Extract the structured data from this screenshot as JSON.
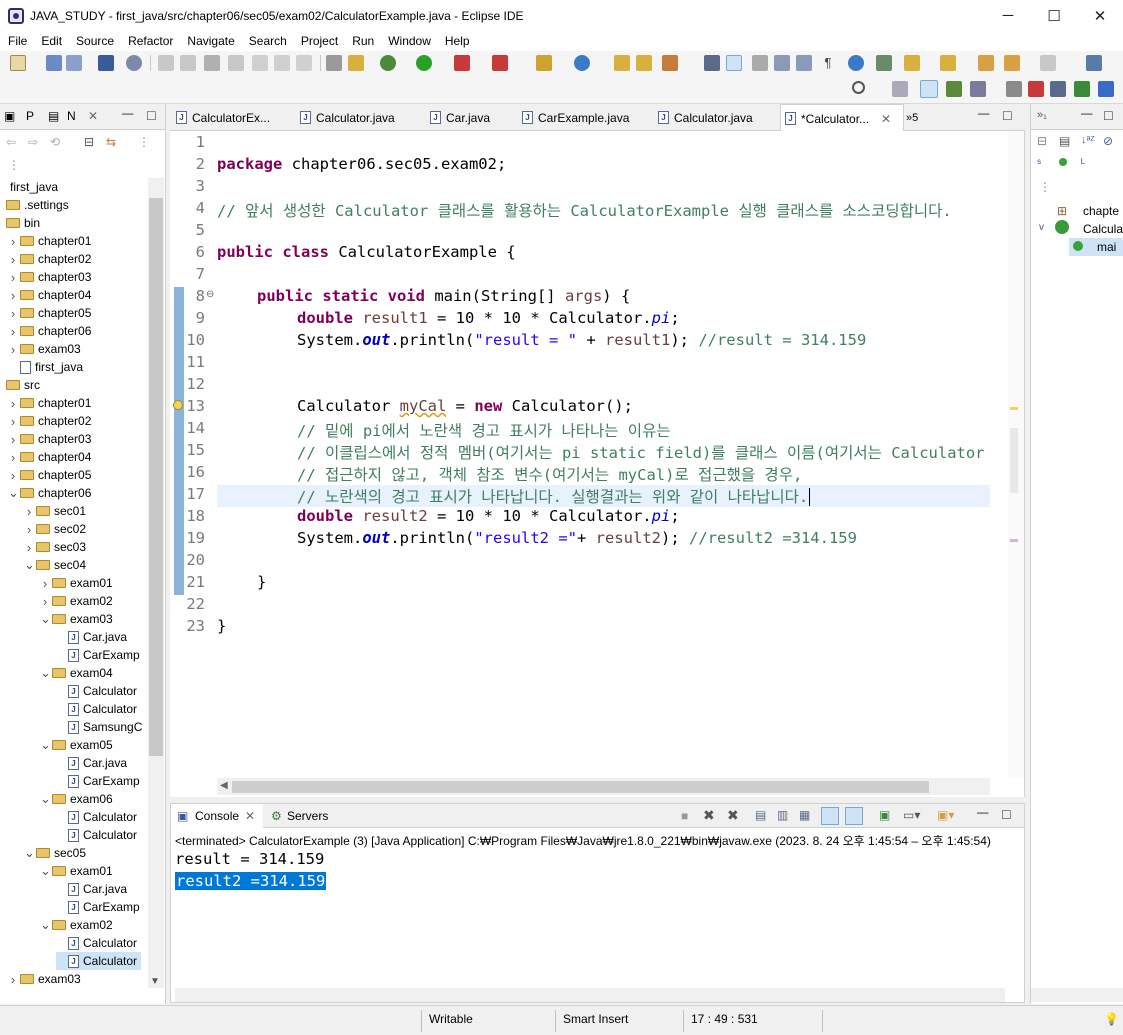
{
  "window": {
    "title": "JAVA_STUDY - first_java/src/chapter06/sec05/exam02/CalculatorExample.java - Eclipse IDE",
    "minimize": "─",
    "maximize": "☐",
    "close": "✕"
  },
  "menu": [
    "File",
    "Edit",
    "Source",
    "Refactor",
    "Navigate",
    "Search",
    "Project",
    "Run",
    "Window",
    "Help"
  ],
  "left_panel": {
    "tab1": "P",
    "tab2": "N",
    "tree": [
      {
        "label": "first_java",
        "depth": 0,
        "kind": "project",
        "chevron": ""
      },
      {
        "label": ".settings",
        "depth": 0,
        "kind": "folder",
        "chevron": ""
      },
      {
        "label": "bin",
        "depth": 0,
        "kind": "folder",
        "chevron": ""
      },
      {
        "label": "chapter01",
        "depth": 1,
        "kind": "folder",
        "chevron": ">"
      },
      {
        "label": "chapter02",
        "depth": 1,
        "kind": "folder",
        "chevron": ">"
      },
      {
        "label": "chapter03",
        "depth": 1,
        "kind": "folder",
        "chevron": ">"
      },
      {
        "label": "chapter04",
        "depth": 1,
        "kind": "folder",
        "chevron": ">"
      },
      {
        "label": "chapter05",
        "depth": 1,
        "kind": "folder",
        "chevron": ">"
      },
      {
        "label": "chapter06",
        "depth": 1,
        "kind": "folder",
        "chevron": ">"
      },
      {
        "label": "exam03",
        "depth": 1,
        "kind": "folder",
        "chevron": ">"
      },
      {
        "label": "first_java",
        "depth": 1,
        "kind": "file",
        "chevron": ""
      },
      {
        "label": "src",
        "depth": 0,
        "kind": "folder",
        "chevron": ""
      },
      {
        "label": "chapter01",
        "depth": 1,
        "kind": "folder",
        "chevron": ">"
      },
      {
        "label": "chapter02",
        "depth": 1,
        "kind": "folder",
        "chevron": ">"
      },
      {
        "label": "chapter03",
        "depth": 1,
        "kind": "folder",
        "chevron": ">"
      },
      {
        "label": "chapter04",
        "depth": 1,
        "kind": "folder",
        "chevron": ">"
      },
      {
        "label": "chapter05",
        "depth": 1,
        "kind": "folder",
        "chevron": ">"
      },
      {
        "label": "chapter06",
        "depth": 1,
        "kind": "folder",
        "chevron": "v"
      },
      {
        "label": "sec01",
        "depth": 2,
        "kind": "folder",
        "chevron": ">"
      },
      {
        "label": "sec02",
        "depth": 2,
        "kind": "folder",
        "chevron": ">"
      },
      {
        "label": "sec03",
        "depth": 2,
        "kind": "folder",
        "chevron": ">"
      },
      {
        "label": "sec04",
        "depth": 2,
        "kind": "folder",
        "chevron": "v"
      },
      {
        "label": "exam01",
        "depth": 3,
        "kind": "folder",
        "chevron": ">"
      },
      {
        "label": "exam02",
        "depth": 3,
        "kind": "folder",
        "chevron": ">"
      },
      {
        "label": "exam03",
        "depth": 3,
        "kind": "folder",
        "chevron": "v"
      },
      {
        "label": "Car.java",
        "depth": 4,
        "kind": "java",
        "chevron": ""
      },
      {
        "label": "CarExamp",
        "depth": 4,
        "kind": "java",
        "chevron": ""
      },
      {
        "label": "exam04",
        "depth": 3,
        "kind": "folder",
        "chevron": "v"
      },
      {
        "label": "Calculator",
        "depth": 4,
        "kind": "java",
        "chevron": ""
      },
      {
        "label": "Calculator",
        "depth": 4,
        "kind": "java",
        "chevron": ""
      },
      {
        "label": "SamsungC",
        "depth": 4,
        "kind": "java",
        "chevron": ""
      },
      {
        "label": "exam05",
        "depth": 3,
        "kind": "folder",
        "chevron": "v"
      },
      {
        "label": "Car.java",
        "depth": 4,
        "kind": "java",
        "chevron": ""
      },
      {
        "label": "CarExamp",
        "depth": 4,
        "kind": "java",
        "chevron": ""
      },
      {
        "label": "exam06",
        "depth": 3,
        "kind": "folder",
        "chevron": "v"
      },
      {
        "label": "Calculator",
        "depth": 4,
        "kind": "java",
        "chevron": ""
      },
      {
        "label": "Calculator",
        "depth": 4,
        "kind": "java",
        "chevron": ""
      },
      {
        "label": "sec05",
        "depth": 2,
        "kind": "folder",
        "chevron": "v"
      },
      {
        "label": "exam01",
        "depth": 3,
        "kind": "folder",
        "chevron": "v"
      },
      {
        "label": "Car.java",
        "depth": 4,
        "kind": "java",
        "chevron": ""
      },
      {
        "label": "CarExamp",
        "depth": 4,
        "kind": "java",
        "chevron": ""
      },
      {
        "label": "exam02",
        "depth": 3,
        "kind": "folder",
        "chevron": "v"
      },
      {
        "label": "Calculator",
        "depth": 4,
        "kind": "java",
        "chevron": ""
      },
      {
        "label": "Calculator",
        "depth": 4,
        "kind": "java",
        "chevron": "",
        "selected": true
      },
      {
        "label": "exam03",
        "depth": 1,
        "kind": "folder",
        "chevron": ">"
      }
    ]
  },
  "editor_tabs": [
    {
      "label": "CalculatorEx...",
      "active": false
    },
    {
      "label": "Calculator.java",
      "active": false
    },
    {
      "label": "Car.java",
      "active": false
    },
    {
      "label": "CarExample.java",
      "active": false
    },
    {
      "label": "Calculator.java",
      "active": false
    },
    {
      "label": "*Calculator...",
      "active": true
    },
    {
      "label": "»5",
      "active": false
    }
  ],
  "code": {
    "line_numbers": [
      "1",
      "2",
      "3",
      "4",
      "5",
      "6",
      "7",
      "8",
      "9",
      "10",
      "11",
      "12",
      "13",
      "14",
      "15",
      "16",
      "17",
      "18",
      "19",
      "20",
      "21",
      "22",
      "23"
    ],
    "l2_kw": "package",
    "l2_rest": " chapter06.sec05.exam02;",
    "l4": "// 앞서 생성한 Calculator 클래스를 활용하는 CalculatorExample 실행 클래스를 소스코딩합니다.",
    "l6_kw": "public class",
    "l6_rest": " CalculatorExample {",
    "l8_kw": "public static void",
    "l8_rest": " main(String[] ",
    "l8_args": "args",
    "l8_end": ") {",
    "l9_kw": "double",
    "l9_var": "result1",
    "l9_mid": " = 10 * 10 * Calculator.",
    "l9_fld": "pi",
    "l9_end": ";",
    "l10_a": "System.",
    "l10_out": "out",
    "l10_b": ".println(",
    "l10_str": "\"result = \"",
    "l10_c": " + ",
    "l10_var": "result1",
    "l10_d": "); ",
    "l10_cm": "//result = 314.159",
    "l13_a": "Calculator ",
    "l13_var": "myCal",
    "l13_b": " = ",
    "l13_kw": "new",
    "l13_c": " Calculator();",
    "l14": "// 밑에 pi에서 노란색 경고 표시가 나타나는 이유는",
    "l15": "// 이클립스에서 정적 멤버(여기서는 pi static field)를 클래스 이름(여기서는 Calculator",
    "l16": "// 접근하지 않고, 객체 참조 변수(여기서는 myCal)로 접근했을 경우,",
    "l17": "// 노란색의 경고 표시가 나타납니다. 실행결과는 위와 같이 나타납니다.",
    "l18_kw": "double",
    "l18_var": "result2",
    "l18_mid": " = 10 * 10 * Calculator.",
    "l18_fld": "pi",
    "l18_end": ";",
    "l19_a": "System.",
    "l19_out": "out",
    "l19_b": ".println(",
    "l19_str": "\"result2 =\"",
    "l19_c": "+ ",
    "l19_var": "result2",
    "l19_d": "); ",
    "l19_cm": "//result2 =314.159",
    "l21": "}",
    "l23": "}"
  },
  "console": {
    "tab_console": "Console",
    "tab_servers": "Servers",
    "info": "<terminated> CalculatorExample (3) [Java Application] C:₩Program Files₩Java₩jre1.8.0_221₩bin₩javaw.exe  (2023. 8. 24 오후 1:45:54 – 오후 1:45:54)",
    "line1": "result = 314.159",
    "line2": "result2 =314.159"
  },
  "right_panel": {
    "items": [
      "chapte",
      "Calcula",
      "mai"
    ]
  },
  "status": {
    "writable": "Writable",
    "insert_mode": "Smart Insert",
    "position": "17 : 49 : 531"
  }
}
